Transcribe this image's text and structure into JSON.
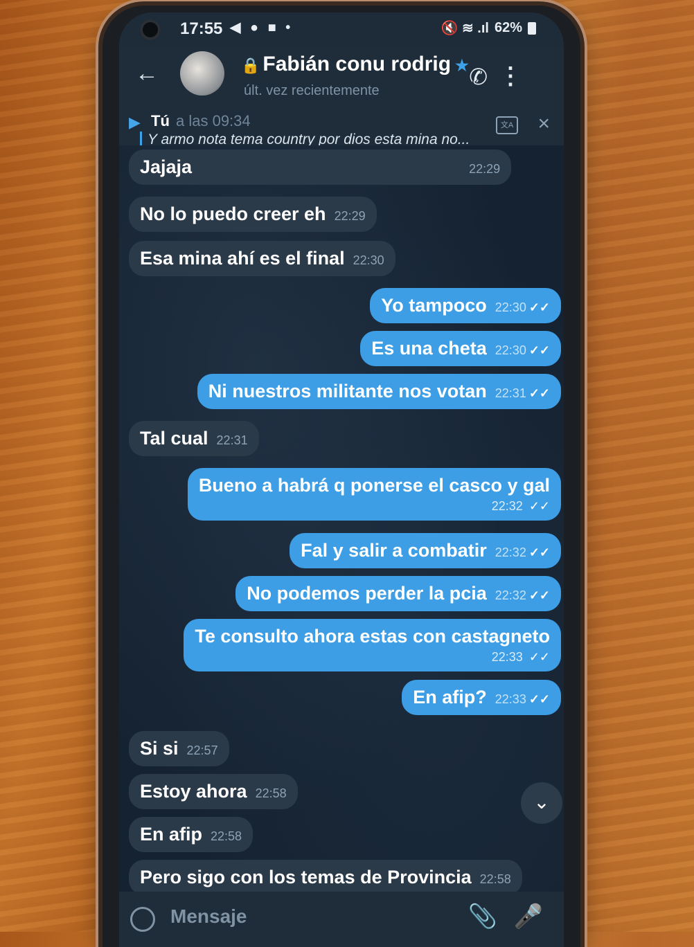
{
  "status_bar": {
    "time": "17:55",
    "left_icons": "◀ ● ■ •",
    "right_icons": "🔇 ≋ .ıl",
    "battery": "62%"
  },
  "header": {
    "contact_name": "Fabián conu rodrig",
    "status": "últ. vez recientemente"
  },
  "pinned": {
    "sender": "Tú",
    "time": "a las 09:34",
    "text": "Y armo nota tema country por dios esta mina no..."
  },
  "messages": [
    {
      "direction": "in",
      "text": "Jajaja",
      "time": "22:29"
    },
    {
      "direction": "in",
      "text": "No lo puedo creer eh",
      "time": "22:29"
    },
    {
      "direction": "in",
      "text": "Esa mina ahí es el final",
      "time": "22:30"
    },
    {
      "direction": "out",
      "text": "Yo tampoco",
      "time": "22:30"
    },
    {
      "direction": "out",
      "text": "Es una cheta",
      "time": "22:30"
    },
    {
      "direction": "out",
      "text": "Ni nuestros militante  nos votan",
      "time": "22:31"
    },
    {
      "direction": "in",
      "text": "Tal cual",
      "time": "22:31"
    },
    {
      "direction": "out",
      "text": "Bueno a habrá q ponerse el casco y gal",
      "time": "22:32"
    },
    {
      "direction": "out",
      "text": "Fal y salir a combatir",
      "time": "22:32"
    },
    {
      "direction": "out",
      "text": "No podemos perder la pcia",
      "time": "22:32"
    },
    {
      "direction": "out",
      "text": "Te consulto ahora estas con castagneto",
      "time": "22:33"
    },
    {
      "direction": "out",
      "text": "En afip?",
      "time": "22:33"
    },
    {
      "direction": "in",
      "text": "Si si",
      "time": "22:57"
    },
    {
      "direction": "in",
      "text": "Estoy ahora",
      "time": "22:58"
    },
    {
      "direction": "in",
      "text": "En afip",
      "time": "22:58"
    },
    {
      "direction": "in",
      "text": "Pero sigo con los temas de Provincia",
      "time": "22:58"
    }
  ],
  "composer": {
    "placeholder": "Mensaje"
  },
  "colors": {
    "outgoing_bubble": "#3d9ee5",
    "incoming_bubble": "#2b3a49",
    "accent": "#46a5e8"
  }
}
